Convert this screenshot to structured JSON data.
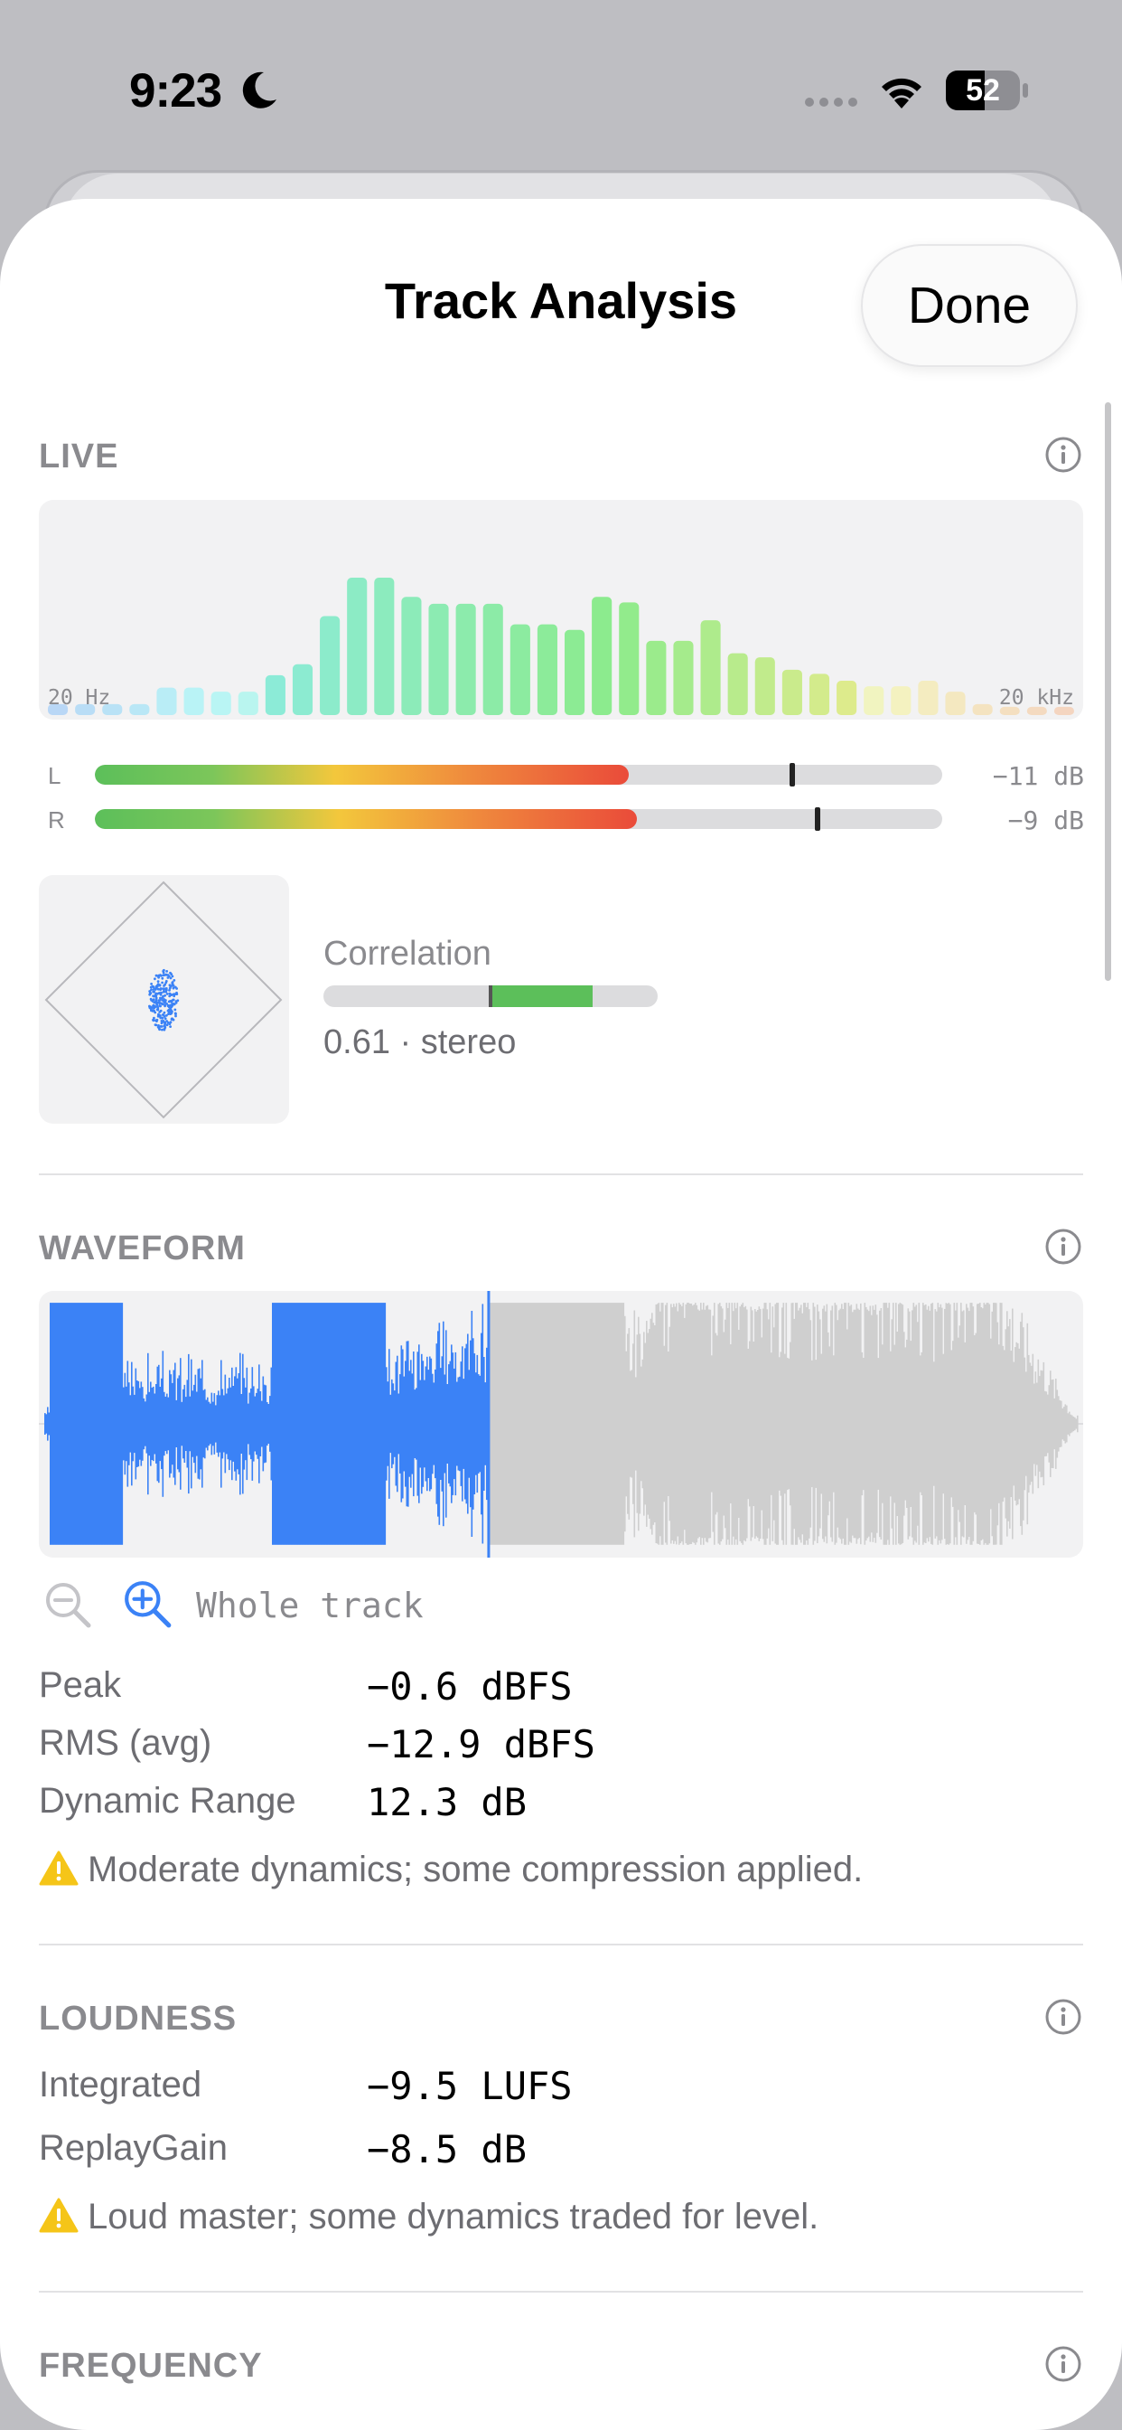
{
  "status_bar": {
    "time": "9:23",
    "battery": "52",
    "battery_level": 0.52
  },
  "header": {
    "title": "Track Analysis",
    "done_label": "Done"
  },
  "live": {
    "section_title": "LIVE",
    "spectrum": {
      "low_label": "20 Hz",
      "high_label": "20 kHz",
      "bar_levels": [
        0.08,
        0.08,
        0.08,
        0.08,
        0.2,
        0.2,
        0.17,
        0.17,
        0.29,
        0.37,
        0.72,
        1.0,
        1.0,
        0.86,
        0.81,
        0.81,
        0.81,
        0.66,
        0.66,
        0.62,
        0.86,
        0.82,
        0.54,
        0.54,
        0.69,
        0.45,
        0.42,
        0.33,
        0.3,
        0.25,
        0.21,
        0.21,
        0.25,
        0.17,
        0.08,
        0.06,
        0.06,
        0.06
      ]
    },
    "meters": [
      {
        "label": "L",
        "level": 0.63,
        "peak": 0.82,
        "value": "−11 dB"
      },
      {
        "label": "R",
        "level": 0.64,
        "peak": 0.85,
        "value": "−9 dB"
      }
    ],
    "correlation": {
      "label": "Correlation",
      "value": 0.61,
      "readout": "0.61 · stereo"
    }
  },
  "waveform": {
    "section_title": "WAVEFORM",
    "playhead": 0.43,
    "zoom_label": "Whole track",
    "stats": [
      {
        "label": "Peak",
        "value": "−0.6 dBFS"
      },
      {
        "label": "RMS (avg)",
        "value": "−12.9 dBFS"
      },
      {
        "label": "Dynamic Range",
        "value": "12.3 dB"
      }
    ],
    "warning": "Moderate dynamics; some compression applied."
  },
  "loudness": {
    "section_title": "LOUDNESS",
    "stats": [
      {
        "label": "Integrated",
        "value": "−9.5 LUFS"
      },
      {
        "label": "ReplayGain",
        "value": "−8.5 dB"
      }
    ],
    "warning": "Loud master; some dynamics traded for level."
  },
  "frequency": {
    "section_title": "FREQUENCY"
  },
  "colors": {
    "accent": "#3b82f6",
    "warning": "#f5c518",
    "meter_green": "#5cbf5a",
    "meter_red": "#ea4b3a",
    "waveform_unplayed": "#cfcfcf"
  }
}
